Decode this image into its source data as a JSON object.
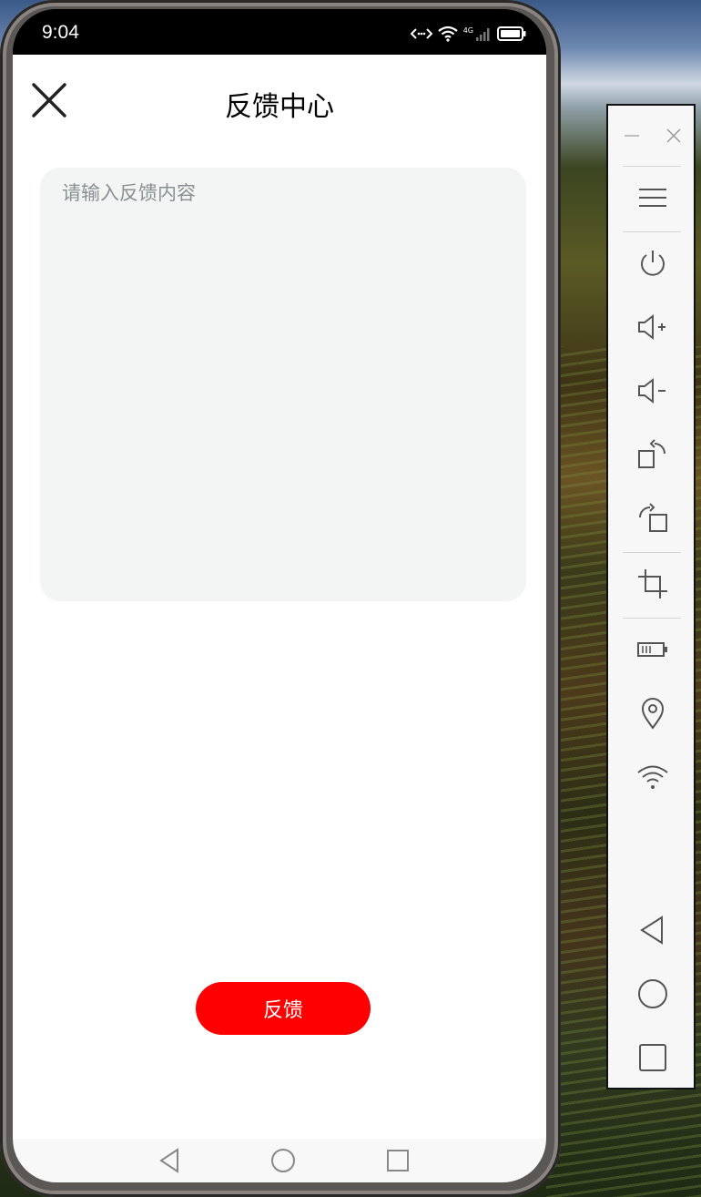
{
  "status_bar": {
    "time": "9:04",
    "network": "4G"
  },
  "header": {
    "title": "反馈中心",
    "close_icon": "close-icon"
  },
  "feedback": {
    "placeholder": "请输入反馈内容",
    "value": ""
  },
  "submit": {
    "label": "反馈",
    "color": "#ff0000"
  },
  "nav": [
    "back-icon",
    "home-icon",
    "recents-icon"
  ],
  "emulator_panel": {
    "buttons": [
      "minimize-icon",
      "close-icon",
      "menu-icon",
      "power-icon",
      "volume-up-icon",
      "volume-down-icon",
      "rotate-left-icon",
      "rotate-right-icon",
      "screenshot-icon",
      "battery-icon",
      "location-icon",
      "wifi-icon",
      "back-icon",
      "home-icon",
      "recents-icon"
    ]
  }
}
